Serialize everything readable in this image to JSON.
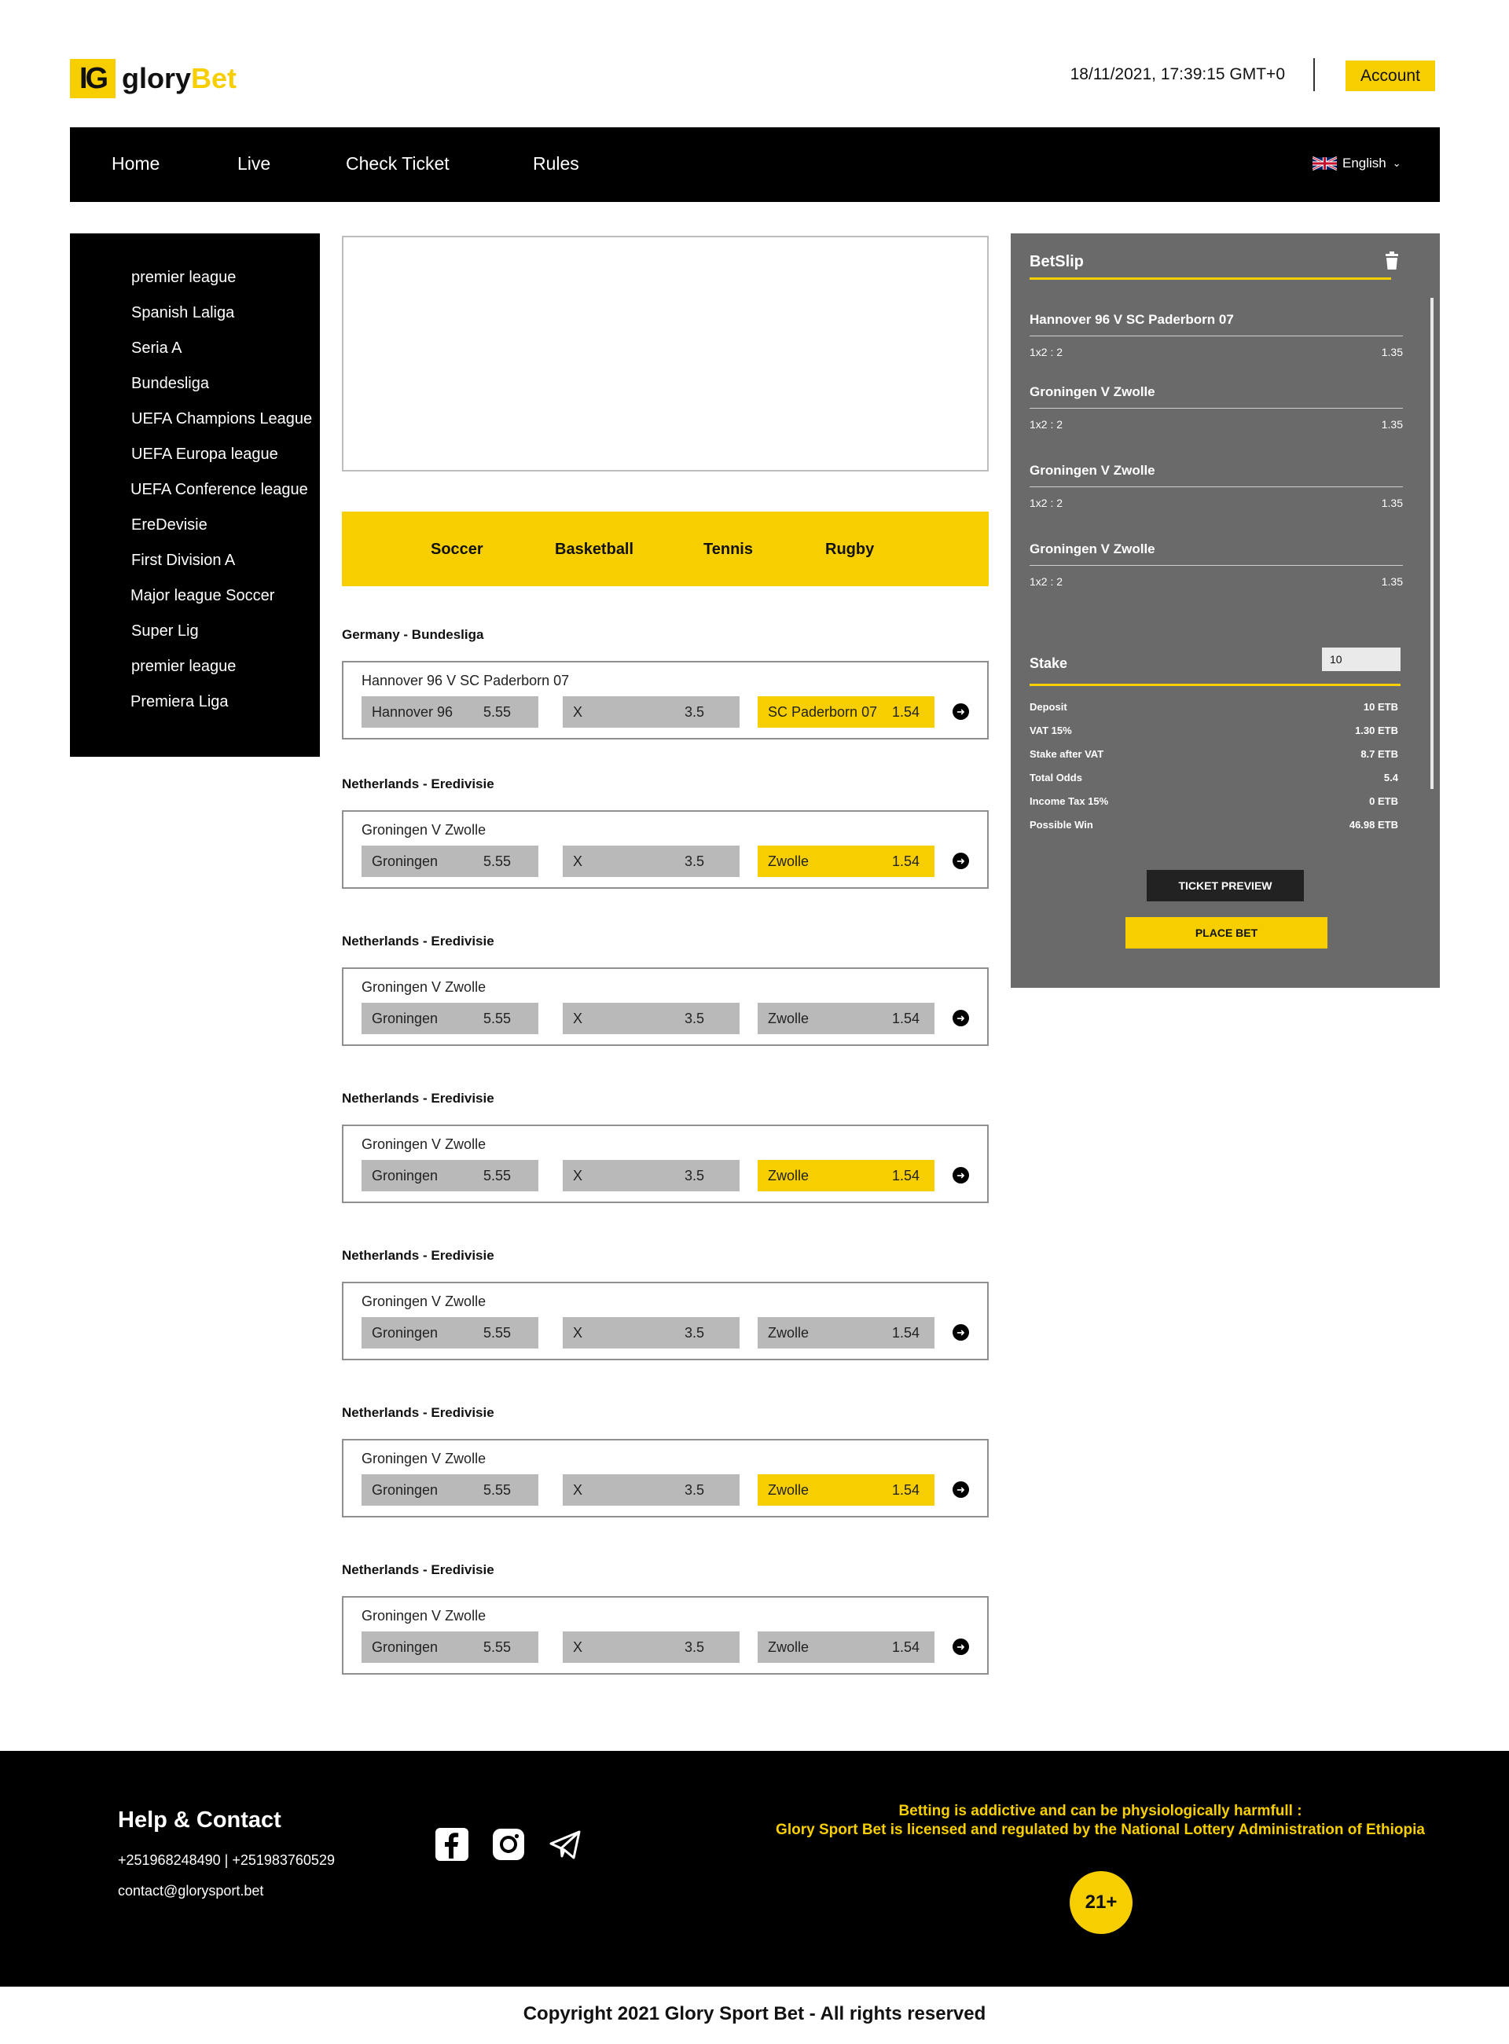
{
  "brand": {
    "logo_mark": "IG",
    "name_part1": "glory",
    "name_part2": "Bet",
    "accent": "#f7cf00"
  },
  "header": {
    "datetime": "18/11/2021, 17:39:15 GMT+0",
    "account_label": "Account"
  },
  "nav": {
    "items": [
      {
        "label": "Home"
      },
      {
        "label": "Live"
      },
      {
        "label": "Check Ticket"
      },
      {
        "label": "Rules"
      }
    ],
    "language": {
      "label": "English",
      "icon": "uk-flag-icon"
    }
  },
  "sidebar": {
    "items": [
      {
        "label": "premier league"
      },
      {
        "label": "Spanish Laliga"
      },
      {
        "label": "Seria A"
      },
      {
        "label": "Bundesliga"
      },
      {
        "label": "UEFA Champions League"
      },
      {
        "label": "UEFA Europa league"
      },
      {
        "label": "UEFA Conference league"
      },
      {
        "label": "EreDevisie"
      },
      {
        "label": "First Division A"
      },
      {
        "label": "Major league Soccer"
      },
      {
        "label": "Super Lig"
      },
      {
        "label": "premier league"
      },
      {
        "label": "Premiera Liga"
      }
    ]
  },
  "sports": {
    "tabs": [
      {
        "label": "Soccer"
      },
      {
        "label": "Basketball"
      },
      {
        "label": "Tennis"
      },
      {
        "label": "Rugby"
      }
    ]
  },
  "matches": [
    {
      "league": "Germany - Bundesliga",
      "name": "Hannover 96 V SC Paderborn 07",
      "home": {
        "label": "Hannover 96",
        "odd": "5.55",
        "selected": false
      },
      "draw": {
        "label": "X",
        "odd": "3.5",
        "selected": false
      },
      "away": {
        "label": "SC Paderborn 07",
        "odd": "1.54",
        "selected": true
      }
    },
    {
      "league": "Netherlands - Eredivisie",
      "name": "Groningen V Zwolle",
      "home": {
        "label": "Groningen",
        "odd": "5.55",
        "selected": false
      },
      "draw": {
        "label": "X",
        "odd": "3.5",
        "selected": false
      },
      "away": {
        "label": "Zwolle",
        "odd": "1.54",
        "selected": true
      }
    },
    {
      "league": "Netherlands - Eredivisie",
      "name": "Groningen V Zwolle",
      "home": {
        "label": "Groningen",
        "odd": "5.55",
        "selected": false
      },
      "draw": {
        "label": "X",
        "odd": "3.5",
        "selected": false
      },
      "away": {
        "label": "Zwolle",
        "odd": "1.54",
        "selected": false
      }
    },
    {
      "league": "Netherlands - Eredivisie",
      "name": "Groningen V Zwolle",
      "home": {
        "label": "Groningen",
        "odd": "5.55",
        "selected": false
      },
      "draw": {
        "label": "X",
        "odd": "3.5",
        "selected": false
      },
      "away": {
        "label": "Zwolle",
        "odd": "1.54",
        "selected": true
      }
    },
    {
      "league": "Netherlands - Eredivisie",
      "name": "Groningen V Zwolle",
      "home": {
        "label": "Groningen",
        "odd": "5.55",
        "selected": false
      },
      "draw": {
        "label": "X",
        "odd": "3.5",
        "selected": false
      },
      "away": {
        "label": "Zwolle",
        "odd": "1.54",
        "selected": false
      }
    },
    {
      "league": "Netherlands - Eredivisie",
      "name": "Groningen V Zwolle",
      "home": {
        "label": "Groningen",
        "odd": "5.55",
        "selected": false
      },
      "draw": {
        "label": "X",
        "odd": "3.5",
        "selected": false
      },
      "away": {
        "label": "Zwolle",
        "odd": "1.54",
        "selected": true
      }
    },
    {
      "league": "Netherlands - Eredivisie",
      "name": "Groningen V Zwolle",
      "home": {
        "label": "Groningen",
        "odd": "5.55",
        "selected": false
      },
      "draw": {
        "label": "X",
        "odd": "3.5",
        "selected": false
      },
      "away": {
        "label": "Zwolle",
        "odd": "1.54",
        "selected": false
      }
    }
  ],
  "betslip": {
    "title": "BetSlip",
    "selections": [
      {
        "match": "Hannover 96 V SC Paderborn 07",
        "market": "1x2 : 2",
        "odd": "1.35"
      },
      {
        "match": "Groningen V Zwolle",
        "market": "1x2 : 2",
        "odd": "1.35"
      },
      {
        "match": "Groningen V Zwolle",
        "market": "1x2 : 2",
        "odd": "1.35"
      },
      {
        "match": "Groningen V Zwolle",
        "market": "1x2 : 2",
        "odd": "1.35"
      }
    ],
    "stake_label": "Stake",
    "stake_value": "10",
    "summary": [
      {
        "label": "Deposit",
        "value": "10 ETB"
      },
      {
        "label": "VAT 15%",
        "value": "1.30 ETB"
      },
      {
        "label": "Stake after VAT",
        "value": "8.7 ETB"
      },
      {
        "label": "Total Odds",
        "value": "5.4"
      },
      {
        "label": "Income Tax 15%",
        "value": "0 ETB"
      },
      {
        "label": "Possible Win",
        "value": "46.98 ETB"
      }
    ],
    "ticket_preview_label": "TICKET PREVIEW",
    "place_bet_label": "PLACE BET"
  },
  "footer": {
    "help_title": "Help & Contact",
    "phones": "+251968248490 | +251983760529",
    "email": "contact@glorysport.bet",
    "social": [
      "facebook-icon",
      "instagram-icon",
      "telegram-icon"
    ],
    "warning_line1": "Betting is addictive and can be physiologically harmfull :",
    "warning_line2": "Glory Sport Bet is licensed and regulated by the National Lottery Administration of Ethiopia",
    "age_badge": "21+",
    "copyright": "Copyright 2021 Glory Sport Bet - All rights reserved"
  }
}
